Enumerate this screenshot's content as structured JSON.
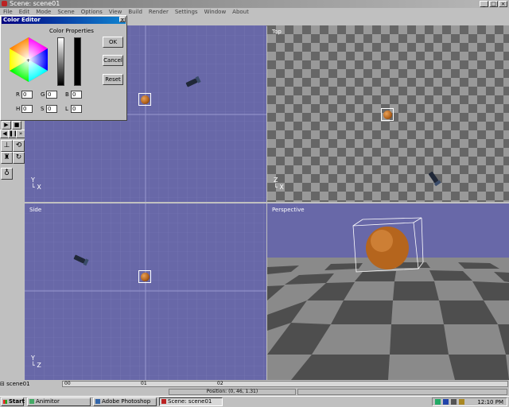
{
  "window": {
    "title": "Scene: scene01"
  },
  "menu": [
    "File",
    "Edit",
    "Mode",
    "Scene",
    "Options",
    "View",
    "Build",
    "Render",
    "Settings",
    "Window",
    "About"
  ],
  "viewports": {
    "front": {
      "label": ""
    },
    "top": {
      "label": "Top",
      "axis_v": "Z",
      "axis_h": "X"
    },
    "side": {
      "label": "Side",
      "axis_v": "Y",
      "axis_h": "Z"
    },
    "perspective": {
      "label": "Perspective"
    },
    "front_axes": {
      "axis_v": "Y",
      "axis_h": "X"
    }
  },
  "colors": {
    "viewport_bg": "#6868a8",
    "checker_dark": "#555555",
    "checker_light": "#999999",
    "sky": "#6868a8"
  },
  "color_editor": {
    "title": "Color Editor",
    "close": "x",
    "header": "Color Properties",
    "ok": "OK",
    "cancel": "Cancel",
    "reset": "Reset",
    "fields": [
      {
        "label": "R",
        "value": "0"
      },
      {
        "label": "G",
        "value": "0"
      },
      {
        "label": "B",
        "value": "0"
      },
      {
        "label": "H",
        "value": "0"
      },
      {
        "label": "S",
        "value": "0"
      },
      {
        "label": "L",
        "value": "0"
      }
    ]
  },
  "status": {
    "scene": "scene01",
    "ruler": [
      "00",
      "01",
      "02"
    ],
    "position": "Position: (0, 46, 1.31)"
  },
  "taskbar": {
    "start": "Start",
    "items": [
      {
        "label": "Animitor",
        "active": false
      },
      {
        "label": "Adobe Photoshop",
        "active": false
      },
      {
        "label": "Scene: scene01",
        "active": true
      }
    ],
    "clock": "12:10 PM"
  },
  "tools": {
    "play_buttons": [
      "▶",
      "■",
      "◀",
      "⏸",
      "▶▶"
    ]
  }
}
